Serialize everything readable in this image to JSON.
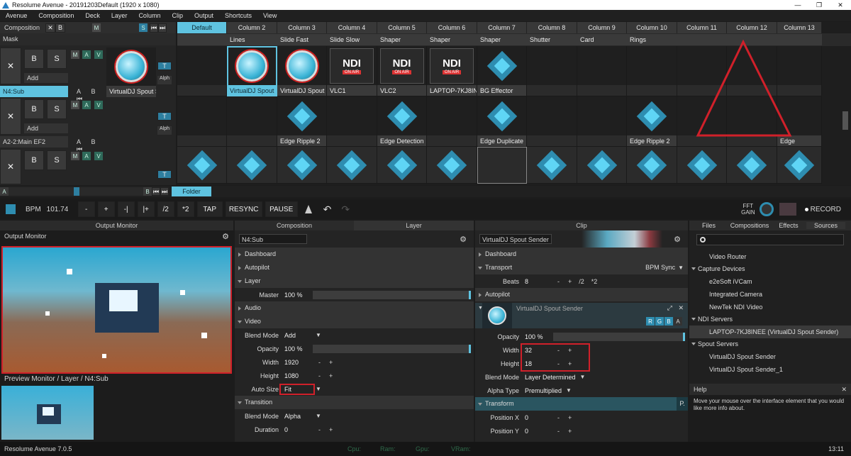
{
  "window": {
    "title": "Resolume Avenue - 20191203Default (1920 x 1080)"
  },
  "menu": [
    "Avenue",
    "Composition",
    "Deck",
    "Layer",
    "Column",
    "Clip",
    "Output",
    "Shortcuts",
    "View"
  ],
  "composition_label": "Composition",
  "deck_tab": "Default",
  "columns": [
    "Column 2",
    "Column 3",
    "Column 4",
    "Column 5",
    "Column 6",
    "Column 7",
    "Column 8",
    "Column 9",
    "Column 10",
    "Column 11",
    "Column 12",
    "Column 13"
  ],
  "mask_label": "Mask",
  "clip_names_top": [
    "Lines",
    "Slide Fast",
    "Slide Slow",
    "Shaper",
    "Shaper",
    "Shaper",
    "Shutter",
    "Card",
    "Rings",
    "",
    "",
    ""
  ],
  "layer1": {
    "name": "N4:Sub",
    "add": "Add",
    "clip_left": "VirtualDJ Spout S...",
    "clips": [
      "VirtualDJ Spout S...",
      "VirtualDJ Spout Se...",
      "VLC1",
      "VLC2",
      "LAPTOP-7KJ8INE...",
      "BG Effector",
      "",
      "",
      "",
      "",
      "",
      ""
    ]
  },
  "layer2": {
    "name": "A2-2:Main EF2",
    "add": "Add",
    "clips": [
      "",
      "Edge Ripple 2",
      "",
      "Edge Detection",
      "",
      "Edge Duplicate",
      "",
      "",
      "Edge Ripple 2",
      "",
      "",
      "Edge"
    ]
  },
  "folder_tab": "Folder",
  "ndi_text": "NDI",
  "ndi_badge": "ON AIR",
  "transport": {
    "bpm_label": "BPM",
    "bpm": "101.74",
    "buttons": [
      "-",
      "+",
      "-|",
      "|+",
      "/2",
      "*2",
      "TAP",
      "RESYNC",
      "PAUSE"
    ],
    "fft": "FFT",
    "gain": "GAIN",
    "record": "RECORD"
  },
  "output_monitor": {
    "tab": "Output Monitor",
    "label": "Output Monitor",
    "preview": "Preview Monitor / Layer / N4:Sub"
  },
  "layer_panel": {
    "tabs": [
      "Composition",
      "Layer"
    ],
    "name": "N4:Sub",
    "sections": {
      "dashboard": "Dashboard",
      "autopilot": "Autopilot",
      "layer": "Layer",
      "audio": "Audio",
      "video": "Video",
      "transition": "Transition"
    },
    "master": {
      "label": "Master",
      "value": "100 %"
    },
    "blend": {
      "label": "Blend Mode",
      "value": "Add"
    },
    "opacity": {
      "label": "Opacity",
      "value": "100 %"
    },
    "width": {
      "label": "Width",
      "value": "1920"
    },
    "height": {
      "label": "Height",
      "value": "1080"
    },
    "autosize": {
      "label": "Auto Size",
      "value": "Fit"
    },
    "t_blend": {
      "label": "Blend Mode",
      "value": "Alpha"
    },
    "duration": {
      "label": "Duration",
      "value": "0"
    }
  },
  "clip_panel": {
    "tab": "Clip",
    "name": "VirtualDJ Spout Sender",
    "sections": {
      "dashboard": "Dashboard",
      "transport": "Transport",
      "autopilot": "Autopilot",
      "transform": "Transform"
    },
    "bpm_sync": "BPM Sync",
    "beats": {
      "label": "Beats",
      "value": "8"
    },
    "beat_ops": [
      "-",
      "+",
      "/2",
      "*2"
    ],
    "source": {
      "name": "VirtualDJ Spout Sender",
      "rgba": [
        "R",
        "G",
        "B",
        "A"
      ]
    },
    "opacity": {
      "label": "Opacity",
      "value": "100 %"
    },
    "width": {
      "label": "Width",
      "value": "32"
    },
    "height": {
      "label": "Height",
      "value": "18"
    },
    "blend": {
      "label": "Blend Mode",
      "value": "Layer Determined"
    },
    "alpha": {
      "label": "Alpha Type",
      "value": "Premultiplied"
    },
    "posx": {
      "label": "Position X",
      "value": "0"
    },
    "posy": {
      "label": "Position Y",
      "value": "0"
    },
    "p_btn": "P."
  },
  "sources": {
    "tabs": [
      "Files",
      "Compositions",
      "Effects",
      "Sources"
    ],
    "items": [
      {
        "kind": "item",
        "text": "Video Router"
      },
      {
        "kind": "head",
        "text": "Capture Devices"
      },
      {
        "kind": "item",
        "text": "e2eSoft iVCam"
      },
      {
        "kind": "item",
        "text": "Integrated Camera"
      },
      {
        "kind": "item",
        "text": "NewTek NDI Video"
      },
      {
        "kind": "head",
        "text": "NDI Servers"
      },
      {
        "kind": "sel",
        "text": "LAPTOP-7KJ8INEE (VirtualDJ Spout Sender)"
      },
      {
        "kind": "head",
        "text": "Spout Servers"
      },
      {
        "kind": "item",
        "text": "VirtualDJ Spout Sender"
      },
      {
        "kind": "item",
        "text": "VirtualDJ Spout Sender_1"
      }
    ]
  },
  "help": {
    "title": "Help",
    "text": "Move your mouse over the interface element that you would like more info about."
  },
  "status": {
    "version": "Resolume Avenue 7.0.5",
    "stats": [
      "Cpu:",
      "Ram:",
      "Gpu:",
      "VRam:"
    ],
    "time": "13:11"
  },
  "colors": {
    "accent": "#5fc3e0",
    "annotation": "#d0202a"
  }
}
